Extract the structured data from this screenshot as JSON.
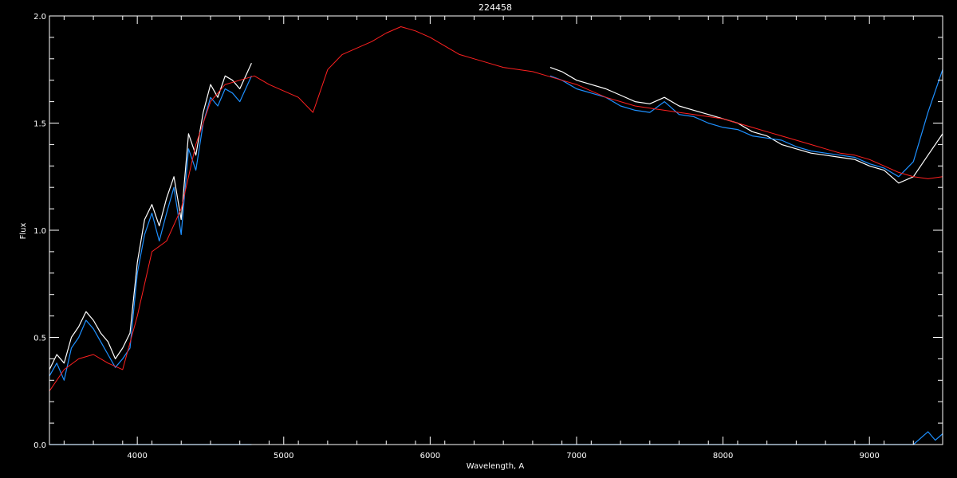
{
  "chart_data": {
    "type": "line",
    "title": "224458",
    "xlabel": "Wavelength, A",
    "ylabel": "Flux",
    "xlim": [
      3400,
      9500
    ],
    "ylim": [
      0.0,
      2.0
    ],
    "grid": false,
    "x_ticks": [
      4000,
      5000,
      6000,
      7000,
      8000,
      9000
    ],
    "x_tick_labels": [
      "4000",
      "5000",
      "6000",
      "7000",
      "8000",
      "9000"
    ],
    "y_ticks": [
      0.0,
      0.5,
      1.0,
      1.5,
      2.0
    ],
    "y_tick_labels": [
      "0.0",
      "0.5",
      "1.0",
      "1.5",
      "2.0"
    ],
    "series": [
      {
        "color": "#ffffff",
        "segments": [
          {
            "x": [
              3400,
              3450,
              3500,
              3550,
              3600,
              3650,
              3700,
              3750,
              3800,
              3850,
              3900,
              3950,
              4000,
              4050,
              4100,
              4150,
              4200,
              4250,
              4300,
              4350,
              4400,
              4450,
              4500,
              4550,
              4600,
              4650,
              4700,
              4780
            ],
            "y": [
              0.35,
              0.42,
              0.38,
              0.5,
              0.55,
              0.62,
              0.58,
              0.52,
              0.48,
              0.4,
              0.45,
              0.52,
              0.85,
              1.05,
              1.12,
              1.02,
              1.15,
              1.25,
              1.05,
              1.45,
              1.35,
              1.55,
              1.68,
              1.62,
              1.72,
              1.7,
              1.66,
              1.78
            ]
          },
          {
            "x": [
              6820,
              6900,
              7000,
              7100,
              7200,
              7300,
              7400,
              7500,
              7600,
              7700,
              7800,
              7900,
              8000,
              8100,
              8200,
              8300,
              8400,
              8500,
              8600,
              8700,
              8800,
              8900,
              9000,
              9100,
              9200,
              9300,
              9400,
              9500
            ],
            "y": [
              1.76,
              1.74,
              1.7,
              1.68,
              1.66,
              1.63,
              1.6,
              1.59,
              1.62,
              1.58,
              1.56,
              1.54,
              1.52,
              1.5,
              1.46,
              1.44,
              1.4,
              1.38,
              1.36,
              1.35,
              1.34,
              1.33,
              1.3,
              1.28,
              1.22,
              1.25,
              1.35,
              1.45
            ]
          }
        ]
      },
      {
        "color": "#1e90ff",
        "segments": [
          {
            "x": [
              3400,
              3450,
              3500,
              3550,
              3600,
              3650,
              3700,
              3750,
              3800,
              3850,
              3900,
              3950,
              4000,
              4050,
              4100,
              4150,
              4200,
              4250,
              4300,
              4350,
              4400,
              4450,
              4500,
              4550,
              4600,
              4650,
              4700,
              4780
            ],
            "y": [
              0.32,
              0.38,
              0.3,
              0.45,
              0.5,
              0.58,
              0.54,
              0.48,
              0.42,
              0.36,
              0.4,
              0.45,
              0.8,
              0.98,
              1.08,
              0.95,
              1.08,
              1.2,
              0.98,
              1.38,
              1.28,
              1.5,
              1.62,
              1.58,
              1.66,
              1.64,
              1.6,
              1.72
            ]
          },
          {
            "x": [
              6820,
              6900,
              7000,
              7100,
              7200,
              7300,
              7400,
              7500,
              7600,
              7700,
              7800,
              7900,
              8000,
              8100,
              8200,
              8300,
              8400,
              8500,
              8600,
              8700,
              8800,
              8900,
              9000,
              9100,
              9200,
              9300,
              9400,
              9500
            ],
            "y": [
              1.72,
              1.7,
              1.66,
              1.64,
              1.62,
              1.58,
              1.56,
              1.55,
              1.6,
              1.54,
              1.53,
              1.5,
              1.48,
              1.47,
              1.44,
              1.43,
              1.42,
              1.39,
              1.37,
              1.36,
              1.35,
              1.34,
              1.31,
              1.29,
              1.25,
              1.32,
              1.55,
              1.75
            ]
          },
          {
            "x": [
              3400,
              4780
            ],
            "y": [
              0.0,
              0.0
            ]
          },
          {
            "x": [
              6820,
              9300,
              9350,
              9400,
              9450,
              9500
            ],
            "y": [
              0.0,
              0.0,
              0.03,
              0.06,
              0.02,
              0.05
            ]
          }
        ]
      },
      {
        "color": "#ff2020",
        "segments": [
          {
            "x": [
              3400,
              3500,
              3600,
              3700,
              3800,
              3900,
              4000,
              4100,
              4200,
              4300,
              4400,
              4500,
              4600,
              4700,
              4800,
              4900,
              5000,
              5100,
              5200,
              5300,
              5400,
              5500,
              5600,
              5700,
              5800,
              5900,
              6000,
              6100,
              6200,
              6300,
              6400,
              6500,
              6600,
              6700,
              6800,
              6900,
              7000,
              7100,
              7200,
              7300,
              7400,
              7500,
              7600,
              7700,
              7800,
              7900,
              8000,
              8100,
              8200,
              8300,
              8400,
              8500,
              8600,
              8700,
              8800,
              8900,
              9000,
              9100,
              9200,
              9300,
              9400,
              9500
            ],
            "y": [
              0.25,
              0.35,
              0.4,
              0.42,
              0.38,
              0.35,
              0.6,
              0.9,
              0.95,
              1.1,
              1.4,
              1.6,
              1.68,
              1.7,
              1.72,
              1.68,
              1.65,
              1.62,
              1.55,
              1.75,
              1.82,
              1.85,
              1.88,
              1.92,
              1.95,
              1.93,
              1.9,
              1.86,
              1.82,
              1.8,
              1.78,
              1.76,
              1.75,
              1.74,
              1.72,
              1.7,
              1.68,
              1.65,
              1.62,
              1.6,
              1.58,
              1.57,
              1.56,
              1.55,
              1.54,
              1.53,
              1.52,
              1.5,
              1.48,
              1.46,
              1.44,
              1.42,
              1.4,
              1.38,
              1.36,
              1.35,
              1.33,
              1.3,
              1.27,
              1.25,
              1.24,
              1.25
            ]
          }
        ]
      }
    ]
  }
}
